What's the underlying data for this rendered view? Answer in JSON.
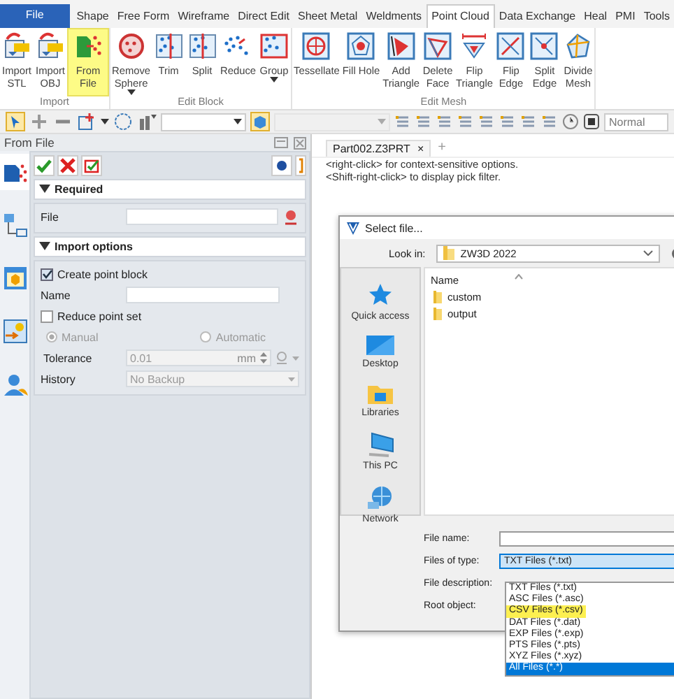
{
  "menu_tabs": [
    {
      "label": "File",
      "kind": "app",
      "selected": false
    },
    {
      "label": "Shape",
      "kind": "tab",
      "selected": false
    },
    {
      "label": "Free Form",
      "kind": "tab",
      "selected": false
    },
    {
      "label": "Wireframe",
      "kind": "tab",
      "selected": false
    },
    {
      "label": "Direct Edit",
      "kind": "tab",
      "selected": false
    },
    {
      "label": "Sheet Metal",
      "kind": "tab",
      "selected": false
    },
    {
      "label": "Weldments",
      "kind": "tab",
      "selected": false
    },
    {
      "label": "Point Cloud",
      "kind": "tab",
      "selected": true
    },
    {
      "label": "Data Exchange",
      "kind": "tab",
      "selected": false
    },
    {
      "label": "Heal",
      "kind": "tab",
      "selected": false
    },
    {
      "label": "PMI",
      "kind": "tab",
      "selected": false
    },
    {
      "label": "Tools",
      "kind": "tab",
      "selected": false
    }
  ],
  "ribbon_groups": [
    {
      "label": "Import",
      "buttons": [
        {
          "lines": [
            "Import",
            "STL"
          ],
          "highlighted": false,
          "dropdown": false
        },
        {
          "lines": [
            "Import",
            "OBJ"
          ],
          "highlighted": false,
          "dropdown": false
        },
        {
          "lines": [
            "From",
            "File"
          ],
          "highlighted": true,
          "dropdown": false
        }
      ]
    },
    {
      "label": "Edit Block",
      "buttons": [
        {
          "lines": [
            "Remove",
            "Sphere"
          ],
          "highlighted": false,
          "dropdown": true
        },
        {
          "lines": [
            "Trim"
          ],
          "highlighted": false,
          "dropdown": false
        },
        {
          "lines": [
            "Split"
          ],
          "highlighted": false,
          "dropdown": false
        },
        {
          "lines": [
            "Reduce"
          ],
          "highlighted": false,
          "dropdown": false
        },
        {
          "lines": [
            "Group"
          ],
          "highlighted": false,
          "dropdown": true
        }
      ]
    },
    {
      "label": "Edit Mesh",
      "buttons": [
        {
          "lines": [
            "Tessellate"
          ],
          "highlighted": false,
          "dropdown": false
        },
        {
          "lines": [
            "Fill Hole"
          ],
          "highlighted": false,
          "dropdown": false
        },
        {
          "lines": [
            "Add",
            "Triangle"
          ],
          "highlighted": false,
          "dropdown": false
        },
        {
          "lines": [
            "Delete",
            "Face"
          ],
          "highlighted": false,
          "dropdown": false
        },
        {
          "lines": [
            "Flip",
            "Triangle"
          ],
          "highlighted": false,
          "dropdown": false
        },
        {
          "lines": [
            "Flip",
            "Edge"
          ],
          "highlighted": false,
          "dropdown": false
        },
        {
          "lines": [
            "Split",
            "Edge"
          ],
          "highlighted": false,
          "dropdown": false
        },
        {
          "lines": [
            "Divide",
            "Mesh"
          ],
          "highlighted": false,
          "dropdown": false
        }
      ]
    }
  ],
  "toolbar": {
    "view_field": "Normal"
  },
  "command_panel": {
    "title": "From File",
    "side_tabs": [
      {
        "selected": true
      },
      {
        "selected": false
      },
      {
        "selected": false
      },
      {
        "selected": false
      }
    ],
    "sections": [
      {
        "title": "Required",
        "expanded": true,
        "rows": [
          {
            "kind": "file",
            "label": "File"
          }
        ]
      },
      {
        "title": "Import options",
        "expanded": true,
        "rows": [
          {
            "kind": "checkbox",
            "label": "Create point block",
            "checked": true
          },
          {
            "kind": "field",
            "label": "Name"
          },
          {
            "kind": "checkbox",
            "label": "Reduce point set",
            "checked": false
          },
          {
            "kind": "radios",
            "disabled": true,
            "options": [
              {
                "label": "Manual",
                "selected": true
              },
              {
                "label": "Automatic",
                "selected": false
              }
            ]
          },
          {
            "kind": "number",
            "label": "Tolerance",
            "value": "0.01",
            "unit": "mm",
            "disabled": true
          },
          {
            "kind": "select",
            "label": "History",
            "value": "No Backup",
            "disabled": true
          }
        ]
      }
    ]
  },
  "document": {
    "tab": "Part002.Z3PRT",
    "close": "×",
    "new_tab": "+",
    "messages": [
      "<right-click> for context-sensitive options.",
      "<Shift-right-click> to display pick filter."
    ]
  },
  "dialog": {
    "title": "Select file...",
    "look_in_label": "Look in:",
    "look_in": "ZW3D 2022",
    "places": [
      "Quick access",
      "Desktop",
      "Libraries",
      "This PC",
      "Network"
    ],
    "list_header": "Name",
    "files": [
      "custom",
      "output"
    ],
    "file_name_label": "File name:",
    "file_types_label": "Files of type:",
    "file_type": "TXT Files (*.txt)",
    "file_type_options": [
      {
        "label": "TXT Files (*.txt)",
        "selected": false,
        "highlighted": false
      },
      {
        "label": "ASC Files (*.asc)",
        "selected": false,
        "highlighted": false
      },
      {
        "label": "CSV Files (*.csv)",
        "selected": false,
        "highlighted": true
      },
      {
        "label": "DAT Files (*.dat)",
        "selected": false,
        "highlighted": false
      },
      {
        "label": "EXP Files (*.exp)",
        "selected": false,
        "highlighted": false
      },
      {
        "label": "PTS Files (*.pts)",
        "selected": false,
        "highlighted": false
      },
      {
        "label": "XYZ Files (*.xyz)",
        "selected": false,
        "highlighted": false
      },
      {
        "label": "All Files (*.*)",
        "selected": true,
        "highlighted": false
      }
    ],
    "file_description_label": "File description:",
    "root_object_label": "Root object:"
  }
}
